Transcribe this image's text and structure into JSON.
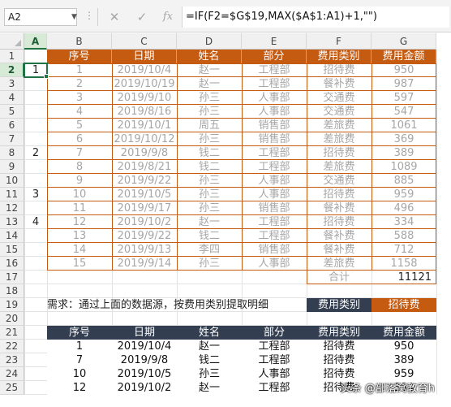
{
  "formula_bar": {
    "name_box": "A2",
    "name_box_arrow": "▼",
    "dots": "⋮",
    "cancel": "✕",
    "enter": "✓",
    "fx": "fx",
    "formula": "=IF(F2=$G$19,MAX($A$1:A1)+1,\"\")"
  },
  "columns": [
    "A",
    "B",
    "C",
    "D",
    "E",
    "F",
    "G"
  ],
  "rows": [
    "1",
    "2",
    "3",
    "4",
    "5",
    "6",
    "7",
    "8",
    "9",
    "10",
    "11",
    "12",
    "13",
    "14",
    "15",
    "16",
    "17",
    "18",
    "19",
    "20",
    "21",
    "22",
    "23",
    "24",
    "25"
  ],
  "source_table": {
    "headers": [
      "序号",
      "日期",
      "姓名",
      "部分",
      "费用类别",
      "费用金额"
    ],
    "rows": [
      [
        "1",
        "2019/10/4",
        "赵一",
        "工程部",
        "招待费",
        "950"
      ],
      [
        "2",
        "2019/10/19",
        "赵一",
        "工程部",
        "餐补费",
        "987"
      ],
      [
        "3",
        "2019/9/10",
        "孙三",
        "人事部",
        "交通费",
        "597"
      ],
      [
        "4",
        "2019/8/16",
        "孙三",
        "人事部",
        "交通费",
        "547"
      ],
      [
        "5",
        "2019/10/1",
        "周五",
        "销售部",
        "差旅费",
        "1061"
      ],
      [
        "6",
        "2019/10/12",
        "孙三",
        "销售部",
        "差旅费",
        "369"
      ],
      [
        "7",
        "2019/9/8",
        "钱二",
        "工程部",
        "招待费",
        "389"
      ],
      [
        "8",
        "2019/8/21",
        "钱二",
        "工程部",
        "差旅费",
        "1089"
      ],
      [
        "9",
        "2019/9/22",
        "孙三",
        "人事部",
        "交通费",
        "885"
      ],
      [
        "10",
        "2019/10/5",
        "孙三",
        "人事部",
        "招待费",
        "959"
      ],
      [
        "11",
        "2019/9/17",
        "孙三",
        "销售部",
        "餐补费",
        "496"
      ],
      [
        "12",
        "2019/10/2",
        "赵一",
        "工程部",
        "招待费",
        "334"
      ],
      [
        "13",
        "2019/9/22",
        "钱二",
        "工程部",
        "餐补费",
        "588"
      ],
      [
        "14",
        "2019/9/13",
        "李四",
        "销售部",
        "餐补费",
        "712"
      ],
      [
        "15",
        "2019/9/14",
        "孙三",
        "人事部",
        "差旅费",
        "1158"
      ]
    ],
    "col_a_values": [
      "1",
      "",
      "",
      "",
      "",
      "",
      "2",
      "",
      "",
      "3",
      "",
      "4",
      "",
      "",
      ""
    ],
    "total_label": "合计",
    "total_value": "11121"
  },
  "requirement_text": "需求：通过上面的数据源，按费用类别提取明细",
  "filter": {
    "label": "费用类别",
    "value": "招待费"
  },
  "result_table": {
    "headers": [
      "序号",
      "日期",
      "姓名",
      "部分",
      "费用类别",
      "费用金额"
    ],
    "rows": [
      [
        "1",
        "2019/10/4",
        "赵一",
        "工程部",
        "招待费",
        "950"
      ],
      [
        "7",
        "2019/9/8",
        "钱二",
        "工程部",
        "招待费",
        "389"
      ],
      [
        "10",
        "2019/10/5",
        "孙三",
        "人事部",
        "招待费",
        "959"
      ],
      [
        "12",
        "2019/10/2",
        "赵一",
        "工程部",
        "招待费",
        "334"
      ]
    ]
  },
  "watermark": "头条 @部落窝教育h",
  "colors": {
    "accent": "#c55a11",
    "dark_header": "#333f50",
    "excel_green": "#217346"
  }
}
